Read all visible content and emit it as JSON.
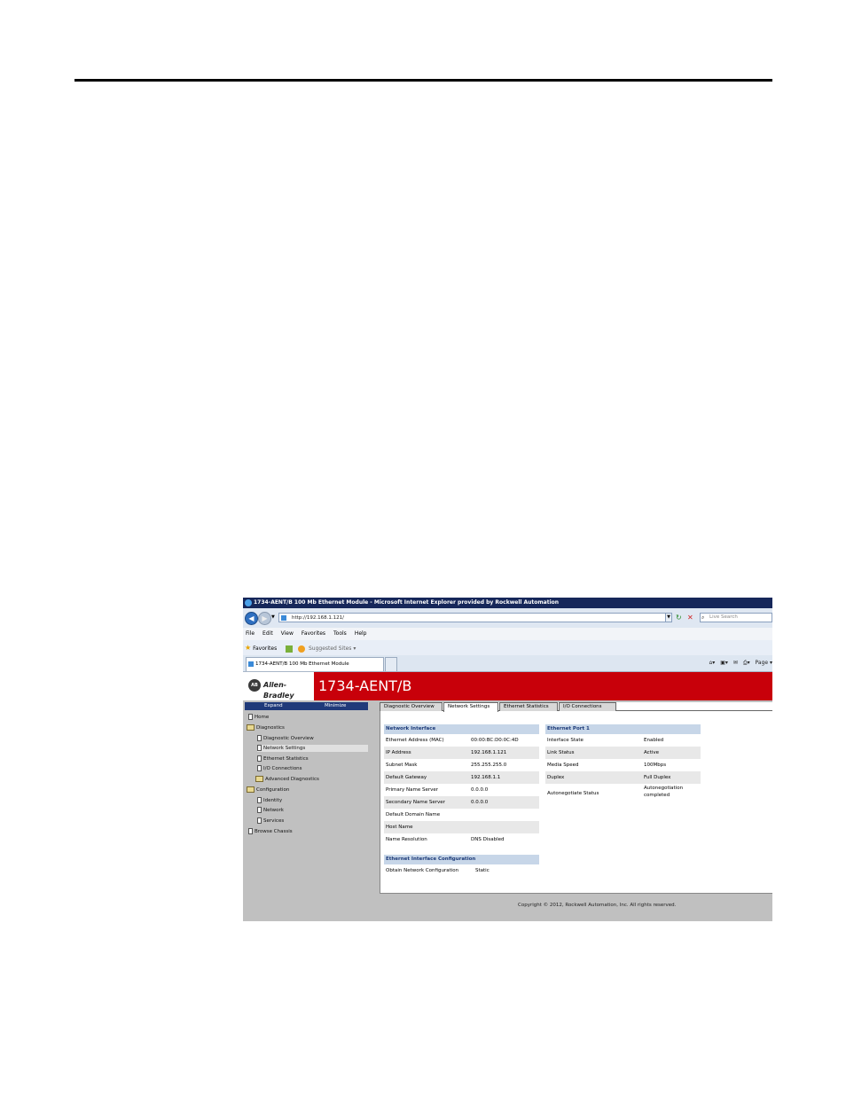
{
  "window": {
    "title": "1734-AENT/B 100 Mb Ethernet Module - Microsoft Internet Explorer provided by Rockwell Automation"
  },
  "addressbar": {
    "url": "http://192.168.1.121/",
    "search_placeholder": "Live Search"
  },
  "menu": [
    "File",
    "Edit",
    "View",
    "Favorites",
    "Tools",
    "Help"
  ],
  "favorites": {
    "label": "Favorites",
    "suggested": "Suggested Sites ▾"
  },
  "browser_tab": {
    "label": "1734-AENT/B 100 Mb Ethernet Module"
  },
  "command_bar": {
    "page": "Page ▾"
  },
  "header": {
    "brand": "Allen-Bradley",
    "brand_badge": "AB",
    "product": "1734-AENT/B"
  },
  "sidebar": {
    "expand": "Expand",
    "minimize": "Minimize",
    "items": [
      {
        "label": "Home"
      },
      {
        "label": "Diagnostics"
      },
      {
        "label": "Diagnostic Overview"
      },
      {
        "label": "Network Settings"
      },
      {
        "label": "Ethernet Statistics"
      },
      {
        "label": "I/O Connections"
      },
      {
        "label": "Advanced Diagnostics"
      },
      {
        "label": "Configuration"
      },
      {
        "label": "Identity"
      },
      {
        "label": "Network"
      },
      {
        "label": "Services"
      },
      {
        "label": "Browse Chassis"
      }
    ]
  },
  "tabs": [
    "Diagnostic Overview",
    "Network Settings",
    "Ethernet Statistics",
    "I/O Connections"
  ],
  "network_interface": {
    "title": "Network Interface",
    "rows": [
      {
        "label": "Ethernet Address (MAC)",
        "value": "00:00:BC:D0:0C:4D"
      },
      {
        "label": "IP Address",
        "value": "192.168.1.121"
      },
      {
        "label": "Subnet Mask",
        "value": "255.255.255.0"
      },
      {
        "label": "Default Gateway",
        "value": "192.168.1.1"
      },
      {
        "label": "Primary Name Server",
        "value": "0.0.0.0"
      },
      {
        "label": "Secondary Name Server",
        "value": "0.0.0.0"
      },
      {
        "label": "Default Domain Name",
        "value": ""
      },
      {
        "label": "Host Name",
        "value": ""
      },
      {
        "label": "Name Resolution",
        "value": "DNS Disabled"
      }
    ]
  },
  "ethernet_port": {
    "title": "Ethernet Port 1",
    "rows": [
      {
        "label": "Interface State",
        "value": "Enabled"
      },
      {
        "label": "Link Status",
        "value": "Active"
      },
      {
        "label": "Media Speed",
        "value": "100Mbps"
      },
      {
        "label": "Duplex",
        "value": "Full Duplex"
      },
      {
        "label": "Autonegotiate Status",
        "value": "Autonegotiation",
        "value2": "completed"
      }
    ]
  },
  "interface_config": {
    "title": "Ethernet Interface Configuration",
    "rows": [
      {
        "label": "Obtain Network Configuration",
        "value": "Static"
      }
    ]
  },
  "footer": {
    "copyright": "Copyright © 2012, Rockwell Automation, Inc. All rights reserved."
  }
}
